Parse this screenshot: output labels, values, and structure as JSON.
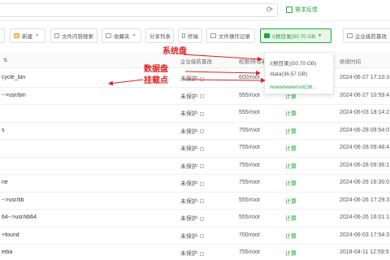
{
  "topbar": {
    "refresh_icon": "refresh-icon",
    "feedback_label": "需求反馈"
  },
  "toolbar": {
    "new_label": "新建",
    "content_search_label": "文件内容搜索",
    "favorites_label": "收藏夹",
    "share_list_label": "分享列表",
    "terminal_label": "终端",
    "file_ops_label": "文件操作记录",
    "disk_label": "/(根目录)50.70 GB",
    "enterprise_label": "企业级防篡改"
  },
  "table": {
    "headers": {
      "protect": "企业级防篡改",
      "perm": "权限/所有者",
      "time": "修改时间"
    },
    "rows": [
      {
        "name": "cycle_bin",
        "protect": "未保护",
        "perm": "600/root",
        "calc": "",
        "time": "2024-06-27 17:10:3"
      },
      {
        "name": "-->usr/bin",
        "protect": "未保护",
        "perm": "555/root",
        "calc": "计算",
        "time": "2024-06-27 10:59:4"
      },
      {
        "name": "",
        "protect": "未保护",
        "perm": "555/root",
        "calc": "计算",
        "time": "2024-06-03 18:14:2"
      },
      {
        "name": "s",
        "protect": "未保护",
        "perm": "755/root",
        "calc": "计算",
        "time": "2024-06-28 09:54:0"
      },
      {
        "name": "",
        "protect": "未保护",
        "perm": "755/root",
        "calc": "计算",
        "time": "2024-06-28 09:48:4"
      },
      {
        "name": "",
        "protect": "未保护",
        "perm": "755/root",
        "calc": "计算",
        "time": "2024-06-28 09:36:1"
      },
      {
        "name": "ne",
        "protect": "未保护",
        "perm": "755/root",
        "calc": "计算",
        "time": "2024-06-26 16:30:0"
      },
      {
        "name": "-->usr/lib",
        "protect": "未保护",
        "perm": "555/root",
        "calc": "计算",
        "time": "2024-06-26 17:29:3"
      },
      {
        "name": "64-->usr/lib64",
        "protect": "未保护",
        "perm": "555/root",
        "calc": "计算",
        "time": "2024-06-26 16:01:1"
      },
      {
        "name": "+found",
        "protect": "未保护",
        "perm": "700/root",
        "calc": "计算",
        "time": "2024-06-03 17:54:3"
      },
      {
        "name": "edia",
        "protect": "未保护",
        "perm": "755/root",
        "calc": "计算",
        "time": "2018-04-11 12:59:5"
      }
    ]
  },
  "dropdown": {
    "items": [
      "/(根目录)(50.70 GB)",
      "/data(36.57 GB)",
      "/www/wwwroot(36..."
    ]
  },
  "annotations": {
    "system_disk": "系统盘",
    "data_disk_1": "数据盘",
    "data_disk_2": "挂载点"
  },
  "colors": {
    "accent": "#20a53a",
    "annotation": "#e02020"
  }
}
